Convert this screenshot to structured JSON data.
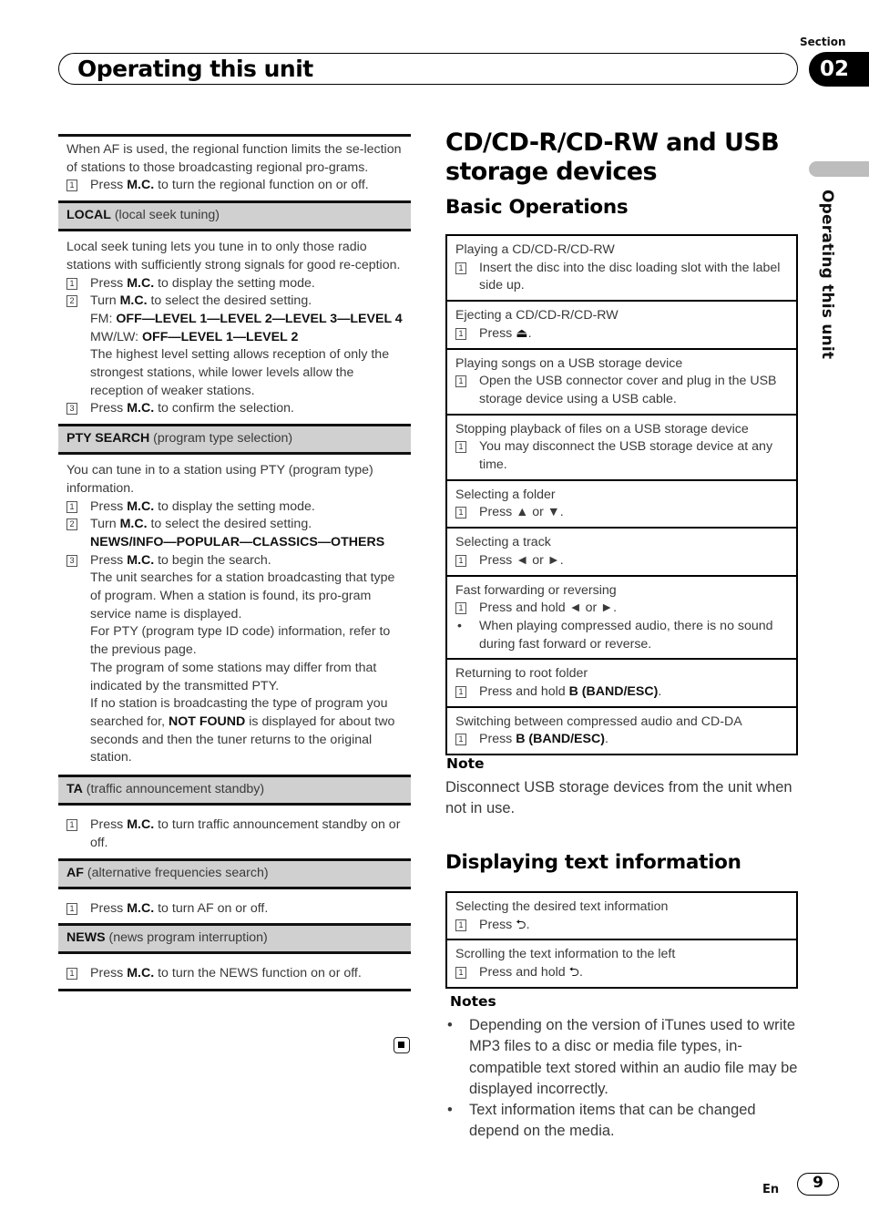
{
  "header": {
    "section_label": "Section",
    "section_number": "02",
    "title": "Operating this unit"
  },
  "side_tab": {
    "label": "Operating this unit"
  },
  "left": {
    "regional_text": "When AF is used, the regional function limits the se-lection of stations to those broadcasting regional pro-grams.",
    "regional_step1_pre": "Press ",
    "regional_step1_key": "M.C.",
    "regional_step1_post": " to turn the regional function on or off.",
    "local": {
      "name": "LOCAL",
      "desc": " (local seek tuning)",
      "intro": "Local seek tuning lets you tune in to only those radio stations with sufficiently strong signals for good re-ception.",
      "s1_pre": "Press ",
      "s1_key": "M.C.",
      "s1_post": " to display the setting mode.",
      "s2_pre": "Turn ",
      "s2_key": "M.C.",
      "s2_post": " to select the desired setting.",
      "fm_label": "FM: ",
      "fm_options": "OFF—LEVEL 1—LEVEL 2—LEVEL 3—LEVEL 4",
      "mw_label": "MW/LW: ",
      "mw_options": "OFF—LEVEL 1—LEVEL 2",
      "s2_note": "The highest level setting allows reception of only the strongest stations, while lower levels allow the reception of weaker stations.",
      "s3_pre": "Press ",
      "s3_key": "M.C.",
      "s3_post": " to confirm the selection."
    },
    "pty": {
      "name": "PTY SEARCH",
      "desc": " (program type selection)",
      "intro": "You can tune in to a station using PTY (program type) information.",
      "s1_pre": "Press ",
      "s1_key": "M.C.",
      "s1_post": " to display the setting mode.",
      "s2_pre": "Turn ",
      "s2_key": "M.C.",
      "s2_post": " to select the desired setting.",
      "options": "NEWS/INFO—POPULAR—CLASSICS—OTHERS",
      "s3_pre": "Press ",
      "s3_key": "M.C.",
      "s3_post": " to begin the search.",
      "p1": "The unit searches for a station broadcasting that type of program. When a station is found, its pro-gram service name is displayed.",
      "p2": "For PTY (program type ID code) information, refer to the previous page.",
      "p3": "The program of some stations may differ from that indicated by the transmitted PTY.",
      "p4_pre": "If no station is broadcasting the type of program you searched for, ",
      "p4_key": "NOT FOUND",
      "p4_post": " is displayed for about two seconds and then the tuner returns to the original station."
    },
    "ta": {
      "name": "TA",
      "desc": " (traffic announcement standby)",
      "s1_pre": "Press ",
      "s1_key": "M.C.",
      "s1_post": " to turn traffic announcement standby on or off."
    },
    "af": {
      "name": "AF",
      "desc": " (alternative frequencies search)",
      "s1_pre": "Press ",
      "s1_key": "M.C.",
      "s1_post": " to turn AF on or off."
    },
    "news": {
      "name": "NEWS",
      "desc": " (news program interruption)",
      "s1_pre": "Press ",
      "s1_key": "M.C.",
      "s1_post": " to turn the NEWS function on or off."
    },
    "step_number": "1",
    "step_number_2": "2",
    "step_number_3": "3"
  },
  "right": {
    "title": "CD/CD-R/CD-RW and USB storage devices",
    "basic_heading": "Basic Operations",
    "basic_rows": [
      {
        "title": "Playing a CD/CD-R/CD-RW",
        "step": "Insert the disc into the disc loading slot with the label side up."
      },
      {
        "title": "Ejecting a CD/CD-R/CD-RW",
        "step_pre": "Press ",
        "step_icon": "⏏",
        "step_post": "."
      },
      {
        "title": "Playing songs on a USB storage device",
        "step": "Open the USB connector cover and plug in the USB storage device using a USB cable."
      },
      {
        "title": "Stopping playback of files on a USB storage device",
        "step": "You may disconnect the USB storage device at any time."
      },
      {
        "title": "Selecting a folder",
        "step": "Press ▲ or ▼."
      },
      {
        "title": "Selecting a track",
        "step": "Press ◄ or ►."
      },
      {
        "title": "Fast forwarding or reversing",
        "step": "Press and hold ◄ or ►.",
        "bullet": "When playing compressed audio, there is no sound during fast forward or reverse."
      },
      {
        "title": "Returning to root folder",
        "step_pre": "Press and hold ",
        "step_key": "B (BAND/ESC)",
        "step_post": "."
      },
      {
        "title": "Switching between compressed audio and CD-DA",
        "step_pre": "Press ",
        "step_key": "B (BAND/ESC)",
        "step_post": "."
      }
    ],
    "note_heading": "Note",
    "note_text": "Disconnect USB storage devices from the unit when not in use.",
    "text_heading": "Displaying text information",
    "text_rows": [
      {
        "title": "Selecting the desired text information",
        "step_pre": "Press ",
        "step_icon": "⮌",
        "step_post": "."
      },
      {
        "title": "Scrolling the text information to the left",
        "step_pre": "Press and hold ",
        "step_icon": "⮌",
        "step_post": "."
      }
    ],
    "notes_heading": "Notes",
    "notes": [
      "Depending on the version of iTunes used to write MP3 files to a disc or media file types, in-compatible text stored within an audio file may be displayed incorrectly.",
      "Text information items that can be changed depend on the media."
    ],
    "bullet": "•"
  },
  "footer": {
    "lang": "En",
    "page": "9"
  },
  "icons": {
    "end_mark": "stop-square-icon",
    "eject": "eject-icon",
    "display": "display-return-icon"
  }
}
